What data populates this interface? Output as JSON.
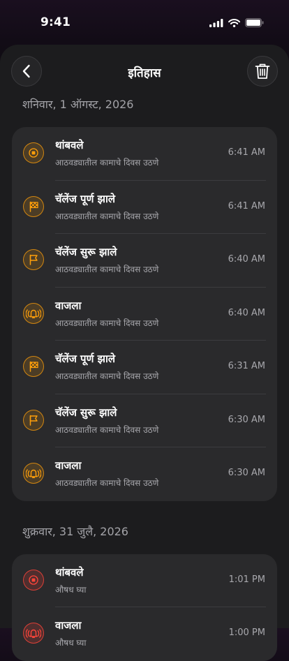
{
  "status": {
    "time": "9:41"
  },
  "header": {
    "title": "इतिहास"
  },
  "colors": {
    "accent_orange": "#ff9f0a",
    "accent_red": "#ff453a"
  },
  "sections": [
    {
      "date": "शनिवार, 1 ऑगस्ट, 2026",
      "items": [
        {
          "icon": "stop-icon",
          "color": "orange",
          "title": "थांबवले",
          "subtitle": "आठवड्यातील कामाचे दिवस उठणे",
          "time": "6:41 AM"
        },
        {
          "icon": "checkered-flag-icon",
          "color": "orange",
          "title": "चॅलेंज पूर्ण झाले",
          "subtitle": "आठवड्यातील कामाचे दिवस उठणे",
          "time": "6:41 AM"
        },
        {
          "icon": "flag-icon",
          "color": "orange",
          "title": "चॅलेंज सुरू झाले",
          "subtitle": "आठवड्यातील कामाचे दिवस उठणे",
          "time": "6:40 AM"
        },
        {
          "icon": "ringing-bell-icon",
          "color": "orange",
          "title": "वाजला",
          "subtitle": "आठवड्यातील कामाचे दिवस उठणे",
          "time": "6:40 AM"
        },
        {
          "icon": "checkered-flag-icon",
          "color": "orange",
          "title": "चॅलेंज पूर्ण झाले",
          "subtitle": "आठवड्यातील कामाचे दिवस उठणे",
          "time": "6:31 AM"
        },
        {
          "icon": "flag-icon",
          "color": "orange",
          "title": "चॅलेंज सुरू झाले",
          "subtitle": "आठवड्यातील कामाचे दिवस उठणे",
          "time": "6:30 AM"
        },
        {
          "icon": "ringing-bell-icon",
          "color": "orange",
          "title": "वाजला",
          "subtitle": "आठवड्यातील कामाचे दिवस उठणे",
          "time": "6:30 AM"
        }
      ]
    },
    {
      "date": "शुक्रवार, 31 जुलै, 2026",
      "items": [
        {
          "icon": "stop-icon",
          "color": "red",
          "title": "थांबवले",
          "subtitle": "औषध घ्या",
          "time": "1:01 PM"
        },
        {
          "icon": "ringing-bell-icon",
          "color": "red",
          "title": "वाजला",
          "subtitle": "औषध घ्या",
          "time": "1:00 PM"
        }
      ]
    }
  ]
}
